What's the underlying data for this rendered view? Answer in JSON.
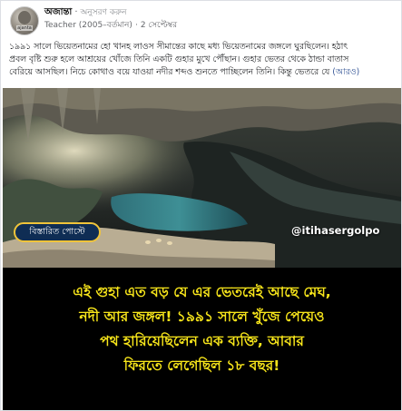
{
  "post": {
    "author": "অজান্তা",
    "follow_label": "অনুসরণ করুন",
    "role": "Teacher (2005–বর্তমান)",
    "date": "2 সেপ্টেম্বর",
    "avatar_text": "ajanta",
    "caption_line1": "১৯৯১ সালে ভিয়েতনামের হো খানহ লাওস সীমান্তের কাছে মধ্য ভিয়েতনামের জঙ্গলে ঘুরছিলেন। হঠাৎ",
    "caption_line2": "প্রবল বৃষ্টি শুরু হলে আশ্রয়ের খোঁজে তিনি একটি গুহার মুখে পৌঁছান। গুহার ভেতর থেকে ঠান্ডা বাতাস",
    "caption_line3": "বেরিয়ে আসছিল। নিচে কোথাও বয়ে যাওয়া নদীর শব্দও শুনতে পাচ্ছিলেন তিনি। কিন্তু ভেতরে যে",
    "see_more": "(আরও)"
  },
  "media": {
    "badge_label": "বিস্তারিত পোস্টে",
    "handle": "@itihasergolpo",
    "headline_lines": [
      "এই গুহা এত বড় যে এর ভেতরেই আছে মেঘ,",
      "নদী আর জঙ্গল! ১৯৯১ সালে খুঁজে পেয়েও",
      "পথ হারিয়েছিলেন এক ব্যক্তি, আবার",
      "ফিরতে লেগেছিল ১৮ বছর!"
    ]
  },
  "colors": {
    "headline_text": "#f7e51a",
    "headline_bg": "#000000",
    "badge_bg": "#0f2d54",
    "badge_border": "#f0c43a",
    "link": "#385898"
  }
}
